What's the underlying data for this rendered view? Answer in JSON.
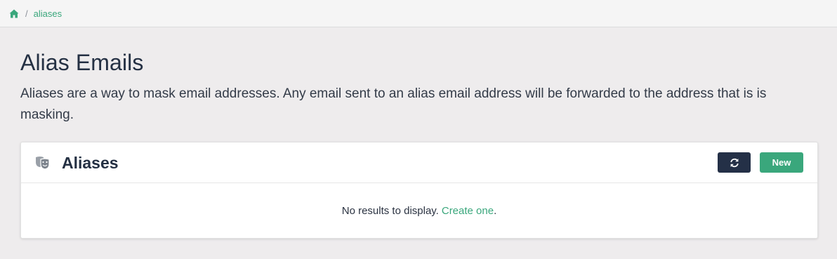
{
  "breadcrumb": {
    "home_icon": "home-icon",
    "separator": "/",
    "current": "aliases"
  },
  "page": {
    "title": "Alias Emails",
    "description": "Aliases are a way to mask email addresses. Any email sent to an alias email address will be forwarded to the address that is is masking."
  },
  "card": {
    "icon": "theater-masks-icon",
    "title": "Aliases",
    "refresh_icon": "refresh-icon",
    "new_label": "New",
    "empty_text": "No results to display.",
    "create_link": "Create one",
    "create_suffix": "."
  },
  "colors": {
    "accent": "#3aa77c",
    "dark_button": "#243047",
    "background": "#eeeced"
  }
}
